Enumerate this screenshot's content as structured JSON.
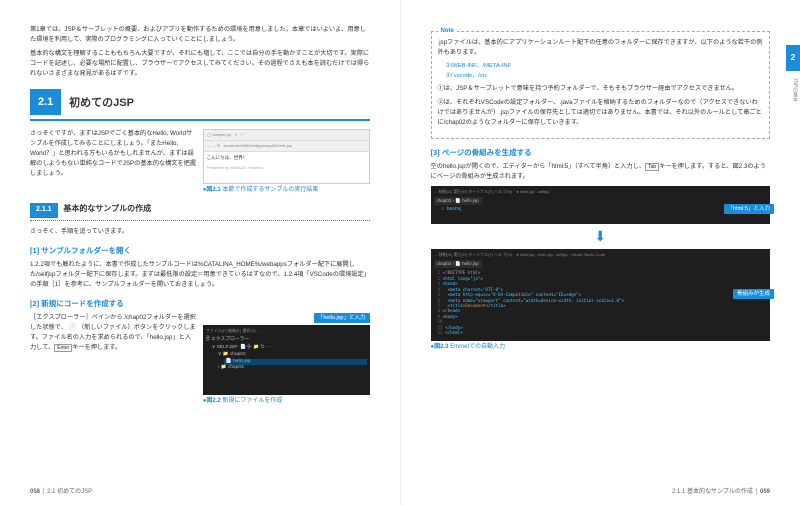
{
  "left": {
    "intro": "第1章では、JSP＆サーブレットの概要、およびアプリを動作するための環境を用意しました。本章ではいよいよ、用意した環境を利用して、実際のプログラミングに入っていくことにしましょう。",
    "intro2": "基本的な構文を理解することももちろん大要ですが、それにも増して、ここでは自分の手を動かすことが大切です。実際にコードを記述し、必要な場所に配置し、ブラウザーでアクセスしてみてください。その過程でさえも本を読むだけでは得られないさまざまな発見があるはずです。",
    "section_num": "2.1",
    "section_title": "初めてのJSP",
    "lead": "さっそくですが、まずはJSPでごく基本的なHello, Worldサンプルを作成してみることにしましょう。「またHello, World？」と思われる方もいるかもしれませんが、まずは誤解のしようもない単純なコードでJSPの基本的な構文を把握しましょう。",
    "fig21_cap_num": "●図2.1",
    "fig21_cap": "本節で作成するサンプルの実行結果",
    "sub_num": "2.1.1",
    "sub_title": "基本的なサンプルの作成",
    "sub_lead": "さっそく、手順を追っていきます。",
    "step1_h": "[1] サンプルフォルダーを開く",
    "step1_p": "1.2.2項でも触れたように、本書で作成したサンプルコードは%CATALINA_HOME%/webappsフォルダー配下に展開した/selfjspフォルダー配下に保存します。まずは最低限の設定＝用意できているはずなので、1.2.4項「VSCodeの環境設定」の手順［1］を参考に、サンプルフォルダーを開いておきましょう。",
    "step2_h": "[2] 新規にコードを作成する",
    "step2_p1": "［エクスプローラー］ペインから /chap02フォルダーを選択した状態で、",
    "step2_p2": "（新しいファイル）ボタンをクリックします。ファイル名の入力を求められるので、「hello.jsp」と入力して、",
    "step2_p3": "キーを押します。",
    "key_enter": "Enter",
    "callout_hello": "「hello.jsp」と入力",
    "fig22_cap_num": "●図2.2",
    "fig22_cap": "新規にファイルを作成",
    "vscode_explorer": "エクスプローラー",
    "vscode_folder": "SELFJSP",
    "vscode_chap": "chap02",
    "vscode_file": "hello.jsp",
    "footer_num": "058",
    "footer_txt": "2.1 初めてのJSP"
  },
  "right": {
    "note_label": "Note",
    "note_intro": ".jspファイルは、基本的にアプリケーションルート配下の任意のフォルダーに保存できますが、以下のような若干の例外もあります。",
    "note_item1": "①/WEB-INF、/META-INF",
    "note_item2": "②/.vscode、/src",
    "note_p1": "①は、JSP＆サーブレットで意味を持つ予約フォルダーで、そもそもブラウザー経由でアクセスできません。",
    "note_p2": "②は、それぞれVSCodeの設定フォルダー、.javaファイルを格納するためのフォルダーなので（アクセスできないわけではありませんが）.jspファイルの保存先としては適切ではありません。本書では、それ以外のルールとして章ごとに/chap02のようなフォルダーに保存していきます。",
    "step3_h": "[3] ページの骨組みを生成する",
    "step3_p": "空のhello.jspが開くので、エディターから「html:5」（すべて半角）と入力し、",
    "step3_p2": "キーを押します。すると、図2.3のようにページの骨組みが生成されます。",
    "key_tab": "Tab",
    "callout_html5": "「html:5」と入力",
    "callout_frame": "骨組みが生成",
    "fig23_cap_num": "●図2.3",
    "fig23_cap": "Emmetでの自動入力",
    "vscode_title": "hello.jsp - selfjsp - Visual Studio Code",
    "vscode_hello_tab": "hello.jsp",
    "emmet_input": "html:5",
    "html_doctype": "<!DOCTYPE html>",
    "html_lang": "<html lang=\"ja\">",
    "html_head": "<head>",
    "html_meta1": "<meta charset=\"UTF-8\">",
    "html_meta2": "<meta http-equiv=\"X-UA-Compatible\" content=\"IE=edge\">",
    "html_meta3": "<meta name=\"viewport\" content=\"width=device-width, initial-scale=1.0\">",
    "html_title": "<title>Document</title>",
    "html_head_c": "</head>",
    "html_body": "<body>",
    "html_body_c": "</body>",
    "html_c": "</html>",
    "tab_num": "2",
    "vtab": "JSPの基本",
    "footer_txt": "2.1.1 基本的なサンプルの作成",
    "footer_num": "059"
  }
}
